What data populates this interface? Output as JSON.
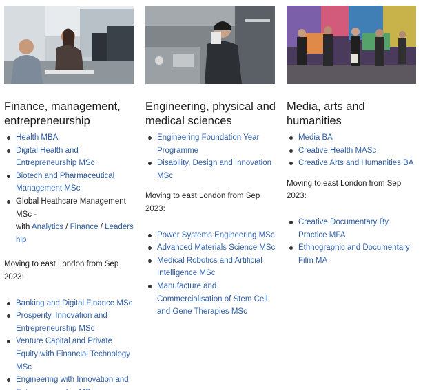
{
  "columns": [
    {
      "heading": "Finance, management, entrepreneurship",
      "image_alt": "students working at computers",
      "items_before": [
        {
          "label": "Health MBA",
          "link": true
        },
        {
          "label": "Digital Health and Entrepreneurship MSc",
          "link": true
        },
        {
          "label": "Biotech and Pharmaceutical Management MSc",
          "link": true
        }
      ],
      "global_item": {
        "text_prefix": "Global Heathcare Management MSc -",
        "with_word": "with ",
        "analytics": "Analytics",
        "sep1": " / ",
        "finance": "Finance",
        "sep2": " / ",
        "leadership": "Leadership"
      },
      "moving_note": "Moving to east London from Sep 2023:",
      "items_after": [
        {
          "label": "Banking and Digital Finance MSc"
        },
        {
          "label": "Prosperity, Innovation and Entrepreneurship MSc"
        },
        {
          "label": "Venture Capital and Private Equity with Financial Technology MSc"
        },
        {
          "label": "Engineering with Innovation and Entrepreneurship MSc"
        }
      ]
    },
    {
      "heading": "Engineering, physical and medical sciences",
      "image_alt": "researcher at lab equipment",
      "items_before": [
        {
          "label": "Engineering Foundation Year Programme"
        },
        {
          "label": "Disability, Design and Innovation MSc"
        }
      ],
      "moving_note": "Moving to east London from Sep 2023:",
      "items_after": [
        {
          "label": "Power Systems Engineering MSc"
        },
        {
          "label": "Advanced Materials Science MSc"
        },
        {
          "label": "Medical Robotics and Artificial Intelligence MSc"
        },
        {
          "label": "Manufacture and Commercialisation of Stem Cell and Gene Therapies MSc"
        }
      ]
    },
    {
      "heading": "Media, arts and humanities",
      "image_alt": "people in front of graffiti wall",
      "items_before": [
        {
          "label": "Media BA"
        },
        {
          "label": "Creative Health MASc"
        },
        {
          "label": "Creative Arts and Humanities BA"
        }
      ],
      "moving_note": "Moving to east London from Sep 2023:",
      "items_after": [
        {
          "label": "Creative Documentary By Practice MFA"
        },
        {
          "label": "Ethnographic and Documentary Film MA"
        }
      ]
    }
  ],
  "colors": {
    "link": "#2f5fa8",
    "text": "#1f1f1f",
    "bullet": "#333333"
  }
}
